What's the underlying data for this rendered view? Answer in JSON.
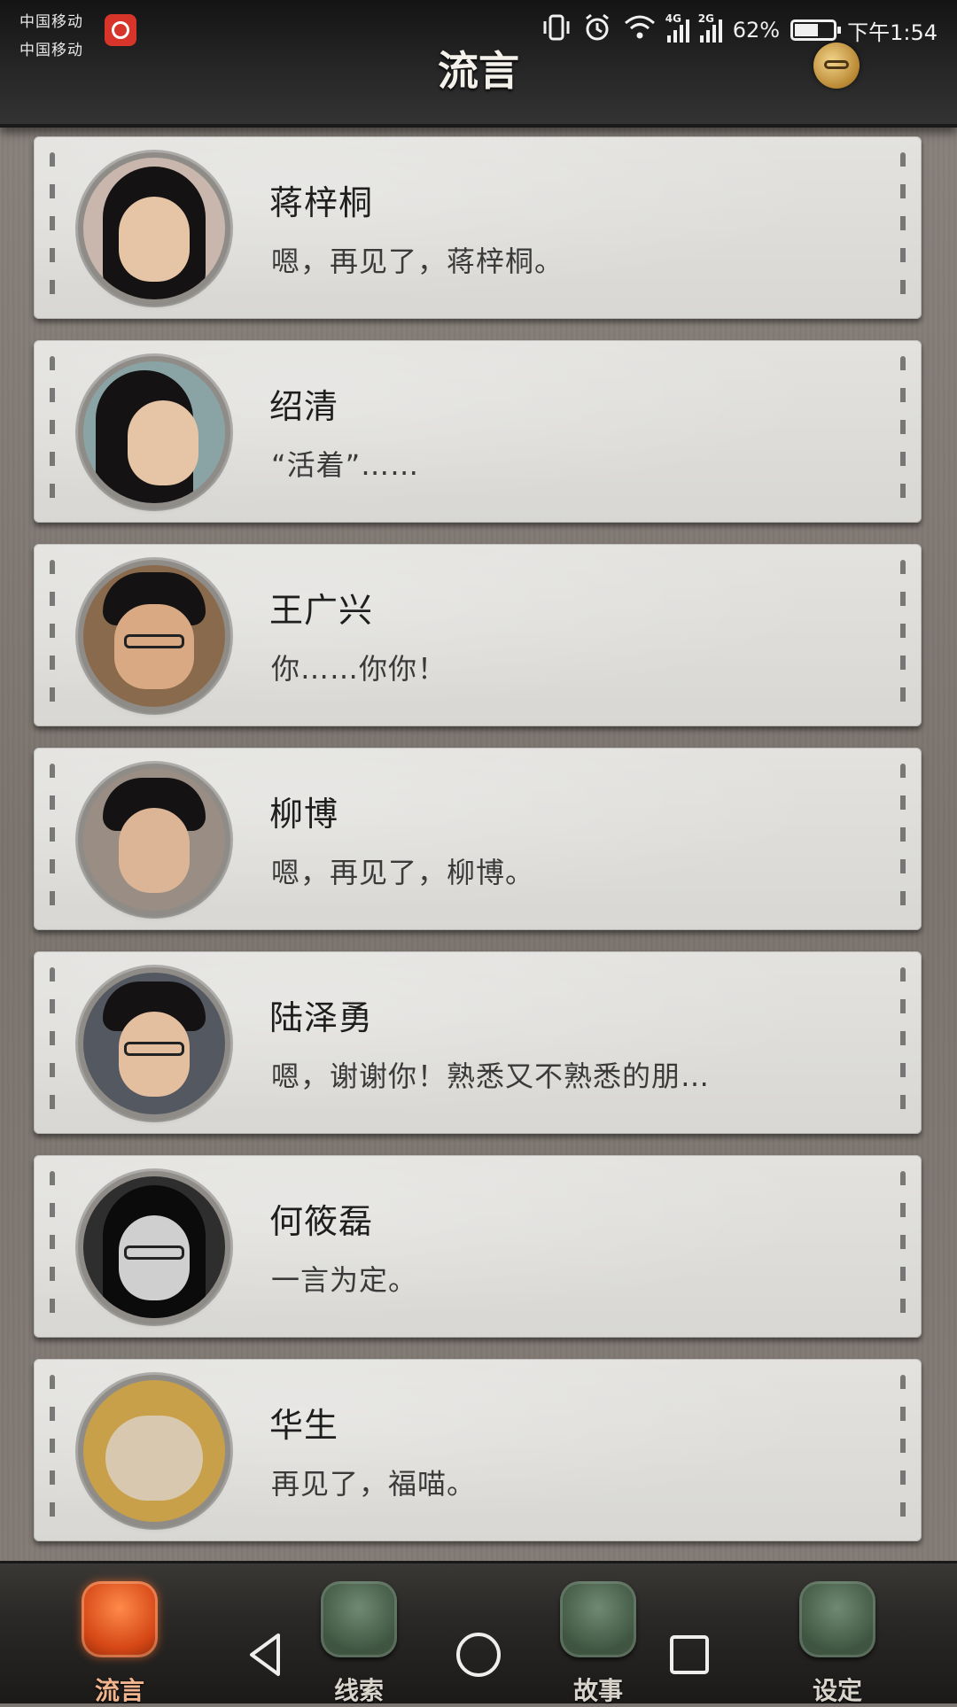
{
  "status_bar": {
    "carrier1": "中国移动",
    "carrier2": "中国移动",
    "network1": "4G",
    "network2": "2G",
    "battery_percent": "62%",
    "battery_level": 0.62,
    "time": "下午1:54"
  },
  "header": {
    "title": "流言"
  },
  "contacts": [
    {
      "name": "蒋梓桐",
      "message": "嗯，再见了，蒋梓桐。"
    },
    {
      "name": "绍清",
      "message": "“活着”……"
    },
    {
      "name": "王广兴",
      "message": "你……你你！"
    },
    {
      "name": "柳博",
      "message": "嗯，再见了，柳博。"
    },
    {
      "name": "陆泽勇",
      "message": "嗯，谢谢你！熟悉又不熟悉的朋…"
    },
    {
      "name": "何筱磊",
      "message": "一言为定。"
    },
    {
      "name": "华生",
      "message": "再见了，福喵。"
    }
  ],
  "tabs": [
    {
      "label": "流言",
      "active": true
    },
    {
      "label": "线索",
      "active": false
    },
    {
      "label": "故事",
      "active": false
    },
    {
      "label": "设定",
      "active": false
    }
  ]
}
